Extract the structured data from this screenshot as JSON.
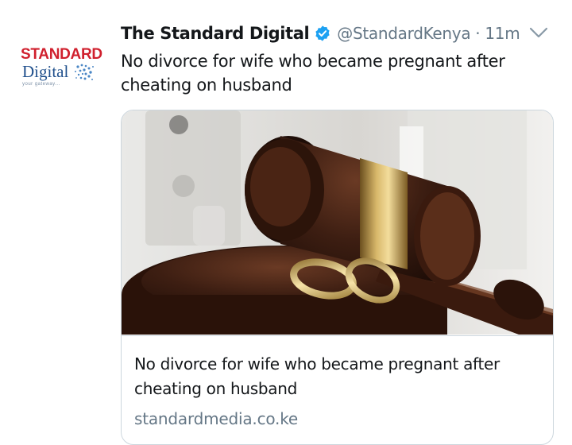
{
  "tweet": {
    "display_name": "The Standard Digital",
    "handle": "@StandardKenya",
    "separator": "·",
    "time": "11m",
    "text": "No divorce for wife who became pregnant after cheating on husband",
    "verified_icon": "verified-badge-icon",
    "menu_icon": "chevron-down-icon"
  },
  "avatar": {
    "line1": "STANDARD",
    "line2": "Digital",
    "tagline": "your gateway..."
  },
  "card": {
    "image_alt": "Judge's gavel with wedding rings",
    "title": "No divorce for wife who became pregnant after cheating on husband",
    "domain": "standardmedia.co.ke"
  },
  "colors": {
    "text": "#14171a",
    "secondary": "#657786",
    "verified": "#1da1f2",
    "border": "#ccd6dd",
    "logo_red": "#d0202e",
    "logo_blue": "#1f4f8c"
  }
}
